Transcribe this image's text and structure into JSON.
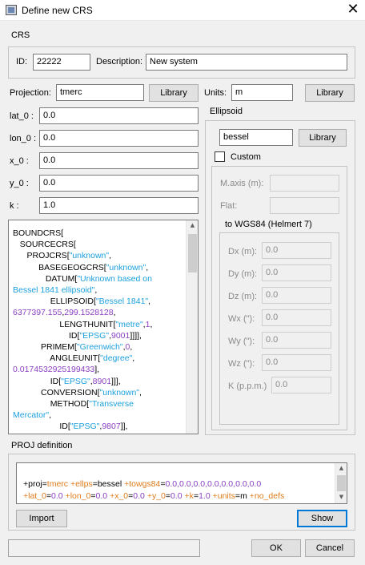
{
  "window": {
    "title": "Define new CRS",
    "close_glyph": "✕"
  },
  "crs_group": {
    "label": "CRS",
    "id_label": "ID:",
    "id_value": "22222",
    "description_label": "Description:",
    "description_value": "New system"
  },
  "projection": {
    "label": "Projection:",
    "value": "tmerc",
    "library_button": "Library"
  },
  "units": {
    "label": "Units:",
    "value": "m",
    "library_button": "Library"
  },
  "params": [
    {
      "label": "lat_0 :",
      "value": "0.0"
    },
    {
      "label": "lon_0 :",
      "value": "0.0"
    },
    {
      "label": "x_0 :",
      "value": "0.0"
    },
    {
      "label": "y_0 :",
      "value": "0.0"
    },
    {
      "label": "k :",
      "value": "1.0"
    }
  ],
  "ellipsoid": {
    "label": "Ellipsoid",
    "value": "bessel",
    "library_button": "Library",
    "custom_label": "Custom",
    "maxis_label": "M.axis (m):",
    "flat_label": "Flat:",
    "towgs_label": "to WGS84 (Helmert 7)",
    "towgs_params": [
      {
        "label": "Dx (m):",
        "value": "0.0"
      },
      {
        "label": "Dy (m):",
        "value": "0.0"
      },
      {
        "label": "Dz (m):",
        "value": "0.0"
      },
      {
        "label": "Wx (\"):",
        "value": "0.0"
      },
      {
        "label": "Wy (\"):",
        "value": "0.0"
      },
      {
        "label": "Wz (\"):",
        "value": "0.0"
      },
      {
        "label": "K (p.p.m.)",
        "value": "0.0"
      }
    ]
  },
  "wkt": {
    "l1": "BOUNDCRS[",
    "l2": "SOURCECRS[",
    "l3a": "PROJCRS[",
    "l3b": "\"unknown\"",
    "l3c": ",",
    "l4a": "BASEGEOGCRS[",
    "l4b": "\"unknown\"",
    "l4c": ",",
    "l5a": "DATUM[",
    "l5b": "\"Unknown based on",
    "l6a": "Bessel 1841 ellipsoid\"",
    "l6b": ",",
    "l7a": "ELLIPSOID[",
    "l7b": "\"Bessel 1841\"",
    "l7c": ",",
    "l8a": "6377397.155",
    "l8b": ",",
    "l8c": "299.1528128",
    "l8d": ",",
    "l9a": "LENGTHUNIT[",
    "l9b": "\"metre\"",
    "l9c": ",",
    "l9d": "1",
    "l9e": ",",
    "l10a": "ID[",
    "l10b": "\"EPSG\"",
    "l10c": ",",
    "l10d": "9001",
    "l10e": "]]]],",
    "l11a": "PRIMEM[",
    "l11b": "\"Greenwich\"",
    "l11c": ",",
    "l11d": "0",
    "l11e": ",",
    "l12a": "ANGLEUNIT[",
    "l12b": "\"degree\"",
    "l12c": ",",
    "l13a": "0.0174532925199433",
    "l13b": "],",
    "l14a": "ID[",
    "l14b": "\"EPSG\"",
    "l14c": ",",
    "l14d": "8901",
    "l14e": "]]],",
    "l15a": "CONVERSION[",
    "l15b": "\"unknown\"",
    "l15c": ",",
    "l16a": "METHOD[",
    "l16b": "\"Transverse",
    "l17a": "Mercator\"",
    "l17b": ",",
    "l18a": "ID[",
    "l18b": "\"EPSG\"",
    "l18c": ",",
    "l18d": "9807",
    "l18e": "]],"
  },
  "proj_definition": {
    "label": "PROJ definition",
    "parts": [
      {
        "k": "+proj",
        "v": "tmerc"
      },
      {
        "k": "+ellps",
        "v": "bessel"
      },
      {
        "k": "+towgs84",
        "v": "0.0,0.0,0.0,0.0,0.0,0.0,0.0"
      },
      {
        "k": "+lat_0",
        "v": "0.0"
      },
      {
        "k": "+lon_0",
        "v": "0.0"
      },
      {
        "k": "+x_0",
        "v": "0.0"
      },
      {
        "k": "+y_0",
        "v": "0.0"
      },
      {
        "k": "+k",
        "v": "1.0"
      },
      {
        "k": "+units",
        "v": "m"
      },
      {
        "k": "+no_defs",
        "v": ""
      }
    ]
  },
  "buttons": {
    "import": "Import",
    "show": "Show",
    "ok": "OK",
    "cancel": "Cancel"
  },
  "icons": {
    "up_arrow": "▲",
    "down_arrow": "▼"
  }
}
